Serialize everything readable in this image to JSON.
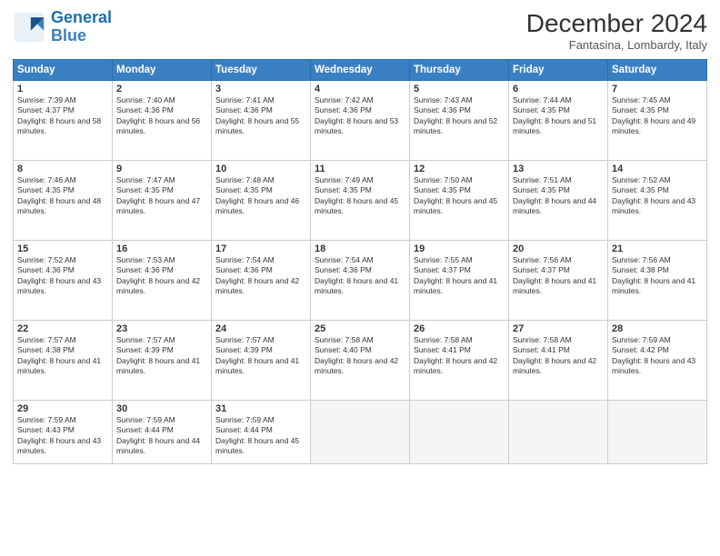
{
  "header": {
    "logo_line1": "General",
    "logo_line2": "Blue",
    "month_title": "December 2024",
    "location": "Fantasina, Lombardy, Italy"
  },
  "weekdays": [
    "Sunday",
    "Monday",
    "Tuesday",
    "Wednesday",
    "Thursday",
    "Friday",
    "Saturday"
  ],
  "days": [
    {
      "num": "",
      "info": ""
    },
    {
      "num": "",
      "info": ""
    },
    {
      "num": "",
      "info": ""
    },
    {
      "num": "",
      "info": ""
    },
    {
      "num": "",
      "info": ""
    },
    {
      "num": "",
      "info": ""
    },
    {
      "num": "1",
      "sunrise": "7:39 AM",
      "sunset": "4:37 PM",
      "daylight": "8 hours and 58 minutes."
    },
    {
      "num": "2",
      "sunrise": "7:40 AM",
      "sunset": "4:36 PM",
      "daylight": "8 hours and 56 minutes."
    },
    {
      "num": "3",
      "sunrise": "7:41 AM",
      "sunset": "4:36 PM",
      "daylight": "8 hours and 55 minutes."
    },
    {
      "num": "4",
      "sunrise": "7:42 AM",
      "sunset": "4:36 PM",
      "daylight": "8 hours and 53 minutes."
    },
    {
      "num": "5",
      "sunrise": "7:43 AM",
      "sunset": "4:36 PM",
      "daylight": "8 hours and 52 minutes."
    },
    {
      "num": "6",
      "sunrise": "7:44 AM",
      "sunset": "4:35 PM",
      "daylight": "8 hours and 51 minutes."
    },
    {
      "num": "7",
      "sunrise": "7:45 AM",
      "sunset": "4:35 PM",
      "daylight": "8 hours and 49 minutes."
    },
    {
      "num": "8",
      "sunrise": "7:46 AM",
      "sunset": "4:35 PM",
      "daylight": "8 hours and 48 minutes."
    },
    {
      "num": "9",
      "sunrise": "7:47 AM",
      "sunset": "4:35 PM",
      "daylight": "8 hours and 47 minutes."
    },
    {
      "num": "10",
      "sunrise": "7:48 AM",
      "sunset": "4:35 PM",
      "daylight": "8 hours and 46 minutes."
    },
    {
      "num": "11",
      "sunrise": "7:49 AM",
      "sunset": "4:35 PM",
      "daylight": "8 hours and 45 minutes."
    },
    {
      "num": "12",
      "sunrise": "7:50 AM",
      "sunset": "4:35 PM",
      "daylight": "8 hours and 45 minutes."
    },
    {
      "num": "13",
      "sunrise": "7:51 AM",
      "sunset": "4:35 PM",
      "daylight": "8 hours and 44 minutes."
    },
    {
      "num": "14",
      "sunrise": "7:52 AM",
      "sunset": "4:35 PM",
      "daylight": "8 hours and 43 minutes."
    },
    {
      "num": "15",
      "sunrise": "7:52 AM",
      "sunset": "4:36 PM",
      "daylight": "8 hours and 43 minutes."
    },
    {
      "num": "16",
      "sunrise": "7:53 AM",
      "sunset": "4:36 PM",
      "daylight": "8 hours and 42 minutes."
    },
    {
      "num": "17",
      "sunrise": "7:54 AM",
      "sunset": "4:36 PM",
      "daylight": "8 hours and 42 minutes."
    },
    {
      "num": "18",
      "sunrise": "7:54 AM",
      "sunset": "4:36 PM",
      "daylight": "8 hours and 41 minutes."
    },
    {
      "num": "19",
      "sunrise": "7:55 AM",
      "sunset": "4:37 PM",
      "daylight": "8 hours and 41 minutes."
    },
    {
      "num": "20",
      "sunrise": "7:56 AM",
      "sunset": "4:37 PM",
      "daylight": "8 hours and 41 minutes."
    },
    {
      "num": "21",
      "sunrise": "7:56 AM",
      "sunset": "4:38 PM",
      "daylight": "8 hours and 41 minutes."
    },
    {
      "num": "22",
      "sunrise": "7:57 AM",
      "sunset": "4:38 PM",
      "daylight": "8 hours and 41 minutes."
    },
    {
      "num": "23",
      "sunrise": "7:57 AM",
      "sunset": "4:39 PM",
      "daylight": "8 hours and 41 minutes."
    },
    {
      "num": "24",
      "sunrise": "7:57 AM",
      "sunset": "4:39 PM",
      "daylight": "8 hours and 41 minutes."
    },
    {
      "num": "25",
      "sunrise": "7:58 AM",
      "sunset": "4:40 PM",
      "daylight": "8 hours and 42 minutes."
    },
    {
      "num": "26",
      "sunrise": "7:58 AM",
      "sunset": "4:41 PM",
      "daylight": "8 hours and 42 minutes."
    },
    {
      "num": "27",
      "sunrise": "7:58 AM",
      "sunset": "4:41 PM",
      "daylight": "8 hours and 42 minutes."
    },
    {
      "num": "28",
      "sunrise": "7:59 AM",
      "sunset": "4:42 PM",
      "daylight": "8 hours and 43 minutes."
    },
    {
      "num": "29",
      "sunrise": "7:59 AM",
      "sunset": "4:43 PM",
      "daylight": "8 hours and 43 minutes."
    },
    {
      "num": "30",
      "sunrise": "7:59 AM",
      "sunset": "4:44 PM",
      "daylight": "8 hours and 44 minutes."
    },
    {
      "num": "31",
      "sunrise": "7:59 AM",
      "sunset": "4:44 PM",
      "daylight": "8 hours and 45 minutes."
    },
    {
      "num": "",
      "info": ""
    },
    {
      "num": "",
      "info": ""
    },
    {
      "num": "",
      "info": ""
    },
    {
      "num": "",
      "info": ""
    }
  ]
}
